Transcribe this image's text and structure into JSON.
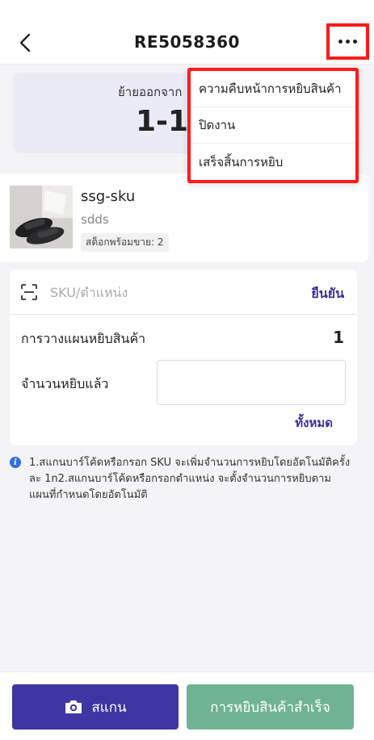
{
  "header": {
    "title": "RE5058360",
    "back_icon": "chevron-left-icon",
    "more_icon": "more-horizontal-icon"
  },
  "banner": {
    "label": "ย้ายออกจาก",
    "value": "1-1-"
  },
  "menu": {
    "items": [
      "ความคืบหน้าการหยิบสินค้า",
      "ปิดงาน",
      "เสร็จสิ้นการหยิบ"
    ]
  },
  "product": {
    "name": "ssg-sku",
    "sub": "sdds",
    "stock": "สต็อกพร้อมขาย: 2"
  },
  "form": {
    "sku_placeholder": "SKU/ตำแหน่ง",
    "confirm_label": "ยืนยัน",
    "plan_label": "การวางแผนหยิบสินค้า",
    "plan_value": "1",
    "picked_label": "จำนวนหยิบแล้ว",
    "picked_value": "",
    "all_label": "ทั้งหมด"
  },
  "info": {
    "text": "1.สแกนบาร์โค้ดหรือกรอก SKU จะเพิ่มจำนวนการหยิบโดยอัตโนมัติครั้งละ 1n2.สแกนบาร์โค้ดหรือกรอกตำแหน่ง จะตั้งจำนวนการหยิบตามแผนที่กำหนดโดยอัตโนมัติ"
  },
  "footer": {
    "scan_label": "สแกน",
    "done_label": "การหยิบสินค้าสำเร็จ"
  },
  "colors": {
    "primary": "#3f35a3",
    "success": "#6fb393",
    "highlight": "#ff1a1a"
  }
}
